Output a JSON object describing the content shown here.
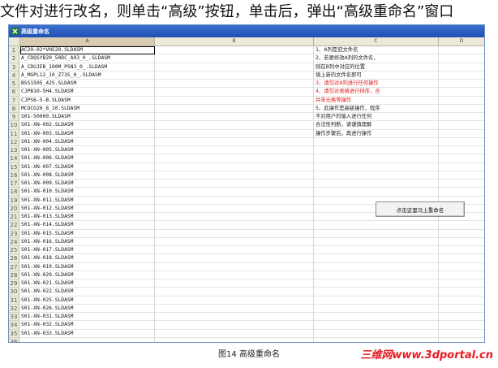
{
  "caption_top": "文件对进行改名，则单击“高级”按钮，单击后，弹出“高级重命名”窗口",
  "window": {
    "title": "高级重命名"
  },
  "column_headers": [
    "A",
    "B",
    "C",
    "D"
  ],
  "rows": [
    {
      "num": "1",
      "a": "AC20-02*VHS20.SLDASM"
    },
    {
      "num": "2",
      "a": "A_CDQSYB20_50DC_A93_0_.SLDASM"
    },
    {
      "num": "3",
      "a": "A_CDUJEB_100M_PSN3_0_.SLDASM"
    },
    {
      "num": "4",
      "a": "A_MGPL12_10_Z73S_0_.SLDASM"
    },
    {
      "num": "5",
      "a": "BSS1505_425.SLDASM"
    },
    {
      "num": "6",
      "a": "CJPB10-5H4.SLDASM"
    },
    {
      "num": "7",
      "a": "CJPS6-5-B.SLDASM"
    },
    {
      "num": "8",
      "a": "MCOCG26_8_10.SLDASM"
    },
    {
      "num": "9",
      "a": "S01-50000.SLDASM"
    },
    {
      "num": "10",
      "a": "S01-XN-002.SLDASM"
    },
    {
      "num": "11",
      "a": "S01-XN-003.SLDASM"
    },
    {
      "num": "12",
      "a": "S01-XN-004.SLDASM"
    },
    {
      "num": "13",
      "a": "S01-XN-005.SLDASM"
    },
    {
      "num": "14",
      "a": "S01-XN-006.SLDASM"
    },
    {
      "num": "15",
      "a": "S01-XN-007.SLDASM"
    },
    {
      "num": "16",
      "a": "S01-XN-008.SLDASM"
    },
    {
      "num": "17",
      "a": "S01-XN-009.SLDASM"
    },
    {
      "num": "18",
      "a": "S01-XN-010.SLDASM"
    },
    {
      "num": "19",
      "a": "S01-XN-011.SLDASM"
    },
    {
      "num": "20",
      "a": "S01-XN-012.SLDASM"
    },
    {
      "num": "21",
      "a": "S01-XN-013.SLDASM"
    },
    {
      "num": "22",
      "a": "S01-XN-014.SLDASM"
    },
    {
      "num": "23",
      "a": "S01-XN-015.SLDASM"
    },
    {
      "num": "24",
      "a": "S01-XN-016.SLDASM"
    },
    {
      "num": "25",
      "a": "S01-XN-017.SLDASM"
    },
    {
      "num": "26",
      "a": "S01-XN-018.SLDASM"
    },
    {
      "num": "27",
      "a": "S01-XN-019.SLDASM"
    },
    {
      "num": "28",
      "a": "S01-XN-020.SLDASM"
    },
    {
      "num": "29",
      "a": "S01-XN-021.SLDASM"
    },
    {
      "num": "30",
      "a": "S01-XN-022.SLDASM"
    },
    {
      "num": "31",
      "a": "S01-XN-025.SLDASM"
    },
    {
      "num": "32",
      "a": "S01-XN-026.SLDASM"
    },
    {
      "num": "33",
      "a": "S01-XN-031.SLDASM"
    },
    {
      "num": "34",
      "a": "S01-XN-032.SLDASM"
    },
    {
      "num": "35",
      "a": "S01-XN-033.SLDASM"
    },
    {
      "num": "36",
      "a": ""
    }
  ],
  "notes": [
    {
      "text": "1、A列是旧文件名",
      "color": "normal"
    },
    {
      "text": "2、若要修改A列的文件名，",
      "color": "normal"
    },
    {
      "text": "则在B列中对应的位置",
      "color": "normal"
    },
    {
      "text": "填上新的文件名即可",
      "color": "normal"
    },
    {
      "text": "3、请勿对A列进行任何操作",
      "color": "red"
    },
    {
      "text": "4、请勿对表格进行排序，合",
      "color": "red"
    },
    {
      "text": "并单元格等操作",
      "color": "red"
    },
    {
      "text": "5、此操作是高级操作，程序",
      "color": "normal"
    },
    {
      "text": "不对用户的输入进行任何",
      "color": "normal"
    },
    {
      "text": "合法性判断，请谨慎理解",
      "color": "normal"
    },
    {
      "text": "操作步骤后，再进行操作",
      "color": "normal"
    }
  ],
  "rename_button_label": "点击这里马上重命名",
  "caption_bottom": "图14 高级重命名",
  "watermark": "三维网www.3dportal.cn",
  "colors": {
    "titlebar": "#1f4fb0",
    "note_red": "#e02020",
    "watermark": "#e8181e"
  }
}
